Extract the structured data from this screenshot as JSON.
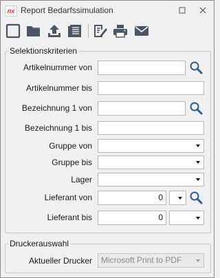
{
  "window": {
    "title": "Report Bedarfssimulation",
    "logo_text": "nx",
    "controls": [
      "maximize-icon",
      "close-icon"
    ]
  },
  "toolbar": {
    "buttons": [
      "new-icon",
      "open-folder-icon",
      "upload-icon",
      "list-icon",
      "edit-icon",
      "print-icon",
      "email-icon"
    ]
  },
  "selection": {
    "legend": "Selektionskriterien",
    "fields": {
      "artikel_von": {
        "label": "Artikelnummer von",
        "value": ""
      },
      "artikel_bis": {
        "label": "Artikelnummer bis",
        "value": ""
      },
      "bez_von": {
        "label": "Bezeichnung 1 von",
        "value": ""
      },
      "bez_bis": {
        "label": "Bezeichnung 1 bis",
        "value": ""
      },
      "gruppe_von": {
        "label": "Gruppe von",
        "value": ""
      },
      "gruppe_bis": {
        "label": "Gruppe bis",
        "value": ""
      },
      "lager": {
        "label": "Lager",
        "value": ""
      },
      "lieferant_von": {
        "label": "Lieferant von",
        "value": "0",
        "select_value": ""
      },
      "lieferant_bis": {
        "label": "Lieferant bis",
        "value": "0",
        "select_value": ""
      }
    }
  },
  "printer": {
    "legend": "Druckerauswahl",
    "label": "Aktueller Drucker",
    "value": "Microsoft Print to PDF"
  },
  "colors": {
    "icon": "#4b5563",
    "search_icon": "#2f5f86",
    "logo": "#e0262b"
  }
}
